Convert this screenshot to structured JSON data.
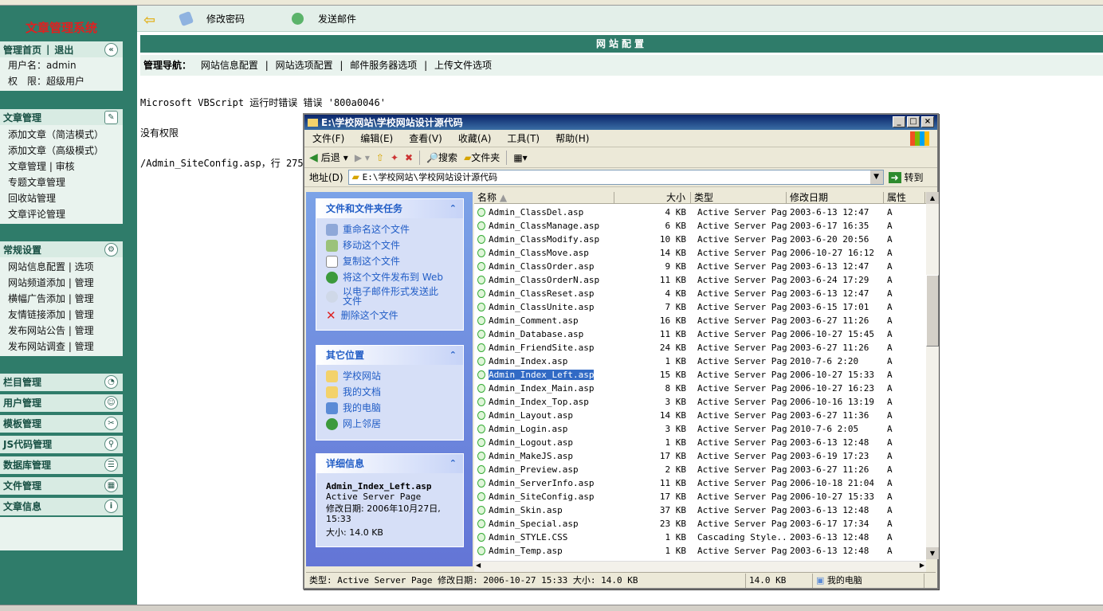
{
  "left": {
    "system_name": "文章管理系统",
    "home_label": "管理首页",
    "sep": "|",
    "logout_label": "退出",
    "user_label": "用户名：admin",
    "role_label": "权　限：超级用户",
    "article_section": {
      "title": "文章管理",
      "items": [
        "添加文章（简洁模式）",
        "添加文章（高级模式）",
        "文章管理 | 审核",
        "专题文章管理",
        "回收站管理",
        "文章评论管理"
      ]
    },
    "settings_section": {
      "title": "常规设置",
      "items": [
        "网站信息配置 | 选项",
        "网站频道添加 | 管理",
        "横幅广告添加 | 管理",
        "友情链接添加 | 管理",
        "发布网站公告 | 管理",
        "发布网站调查 | 管理"
      ]
    },
    "bars": [
      "栏目管理",
      "用户管理",
      "模板管理",
      "JS代码管理",
      "数据库管理",
      "文件管理",
      "文章信息"
    ]
  },
  "toolbar": {
    "change_password": "修改密码",
    "send_mail": "发送邮件"
  },
  "config": {
    "title": "网站配置",
    "nav_label": "管理导航：",
    "nav_items": [
      "网站信息配置",
      "网站选项配置",
      "邮件服务器选项",
      "上传文件选项"
    ]
  },
  "errors": {
    "line1": "Microsoft VBScript 运行时错误 错误 '800a0046'",
    "line2": "没有权限",
    "line3": "/Admin_SiteConfig.asp，行 275"
  },
  "explorer": {
    "title": "E:\\学校网站\\学校网站设计源代码",
    "menus": [
      "文件(F)",
      "编辑(E)",
      "查看(V)",
      "收藏(A)",
      "工具(T)",
      "帮助(H)"
    ],
    "tool_back": "后退",
    "tool_search": "搜索",
    "tool_folders": "文件夹",
    "address_label": "地址(D)",
    "address_value": "E:\\学校网站\\学校网站设计源代码",
    "go_label": "转到",
    "tasks_title": "文件和文件夹任务",
    "tasks": [
      "重命名这个文件",
      "移动这个文件",
      "复制这个文件",
      "将这个文件发布到 Web",
      "以电子邮件形式发送此文件",
      "删除这个文件"
    ],
    "other_title": "其它位置",
    "other": [
      "学校网站",
      "我的文档",
      "我的电脑",
      "网上邻居"
    ],
    "detail_title": "详细信息",
    "detail_name": "Admin_Index_Left.asp",
    "detail_type": "Active Server Page",
    "detail_date": "修改日期: 2006年10月27日, 15:33",
    "detail_size": "大小: 14.0 KB",
    "columns": [
      "名称",
      "大小",
      "类型",
      "修改日期",
      "属性"
    ],
    "files": [
      [
        "Admin_ClassDel.asp",
        "4 KB",
        "Active Server Page",
        "2003-6-13 12:47",
        "A"
      ],
      [
        "Admin_ClassManage.asp",
        "6 KB",
        "Active Server Page",
        "2003-6-17 16:35",
        "A"
      ],
      [
        "Admin_ClassModify.asp",
        "10 KB",
        "Active Server Page",
        "2003-6-20 20:56",
        "A"
      ],
      [
        "Admin_ClassMove.asp",
        "14 KB",
        "Active Server Page",
        "2006-10-27 16:12",
        "A"
      ],
      [
        "Admin_ClassOrder.asp",
        "9 KB",
        "Active Server Page",
        "2003-6-13 12:47",
        "A"
      ],
      [
        "Admin_ClassOrderN.asp",
        "11 KB",
        "Active Server Page",
        "2003-6-24 17:29",
        "A"
      ],
      [
        "Admin_ClassReset.asp",
        "4 KB",
        "Active Server Page",
        "2003-6-13 12:47",
        "A"
      ],
      [
        "Admin_ClassUnite.asp",
        "7 KB",
        "Active Server Page",
        "2003-6-15 17:01",
        "A"
      ],
      [
        "Admin_Comment.asp",
        "16 KB",
        "Active Server Page",
        "2003-6-27 11:26",
        "A"
      ],
      [
        "Admin_Database.asp",
        "11 KB",
        "Active Server Page",
        "2006-10-27 15:45",
        "A"
      ],
      [
        "Admin_FriendSite.asp",
        "24 KB",
        "Active Server Page",
        "2003-6-27 11:26",
        "A"
      ],
      [
        "Admin_Index.asp",
        "1 KB",
        "Active Server Page",
        "2010-7-6 2:20",
        "A"
      ],
      [
        "Admin_Index_Left.asp",
        "15 KB",
        "Active Server Page",
        "2006-10-27 15:33",
        "A"
      ],
      [
        "Admin_Index_Main.asp",
        "8 KB",
        "Active Server Page",
        "2006-10-27 16:23",
        "A"
      ],
      [
        "Admin_Index_Top.asp",
        "3 KB",
        "Active Server Page",
        "2006-10-16 13:19",
        "A"
      ],
      [
        "Admin_Layout.asp",
        "14 KB",
        "Active Server Page",
        "2003-6-27 11:36",
        "A"
      ],
      [
        "Admin_Login.asp",
        "3 KB",
        "Active Server Page",
        "2010-7-6 2:05",
        "A"
      ],
      [
        "Admin_Logout.asp",
        "1 KB",
        "Active Server Page",
        "2003-6-13 12:48",
        "A"
      ],
      [
        "Admin_MakeJS.asp",
        "17 KB",
        "Active Server Page",
        "2003-6-19 17:23",
        "A"
      ],
      [
        "Admin_Preview.asp",
        "2 KB",
        "Active Server Page",
        "2003-6-27 11:26",
        "A"
      ],
      [
        "Admin_ServerInfo.asp",
        "11 KB",
        "Active Server Page",
        "2006-10-18 21:04",
        "A"
      ],
      [
        "Admin_SiteConfig.asp",
        "17 KB",
        "Active Server Page",
        "2006-10-27 15:33",
        "A"
      ],
      [
        "Admin_Skin.asp",
        "37 KB",
        "Active Server Page",
        "2003-6-13 12:48",
        "A"
      ],
      [
        "Admin_Special.asp",
        "23 KB",
        "Active Server Page",
        "2003-6-17 17:34",
        "A"
      ],
      [
        "Admin_STYLE.CSS",
        "1 KB",
        "Cascading Style...",
        "2003-6-13 12:48",
        "A"
      ],
      [
        "Admin_Temp.asp",
        "1 KB",
        "Active Server Page",
        "2003-6-13 12:48",
        "A"
      ]
    ],
    "status_info": "类型: Active Server Page 修改日期: 2006-10-27 15:33 大小: 14.0 KB",
    "status_size": "14.0 KB",
    "status_location": "我的电脑"
  }
}
